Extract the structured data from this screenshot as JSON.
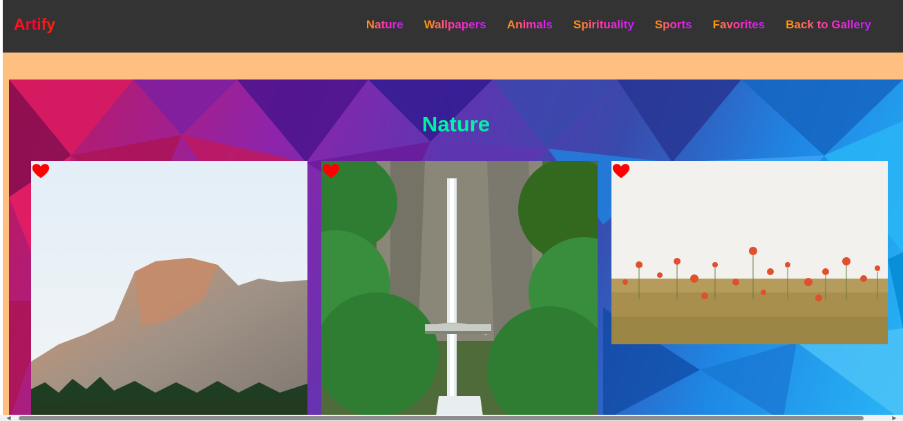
{
  "brand": "Artify",
  "nav": [
    "Nature",
    "Wallpapers",
    "Animals",
    "Spirituality",
    "Sports",
    "Favorites",
    "Back to Gallery"
  ],
  "section_title": "Nature",
  "cards": [
    {
      "name": "half-dome-mountain-image",
      "subject": "granite mountain with pine forest"
    },
    {
      "name": "waterfall-bridge-image",
      "subject": "waterfall with arched bridge in forest"
    },
    {
      "name": "poppy-field-image",
      "subject": "red poppies in wheat field"
    }
  ],
  "icons": {
    "favorite": "heart-icon"
  },
  "colors": {
    "navbar": "#333333",
    "backdrop": "#ffbf80",
    "heart": "#ff0000"
  }
}
